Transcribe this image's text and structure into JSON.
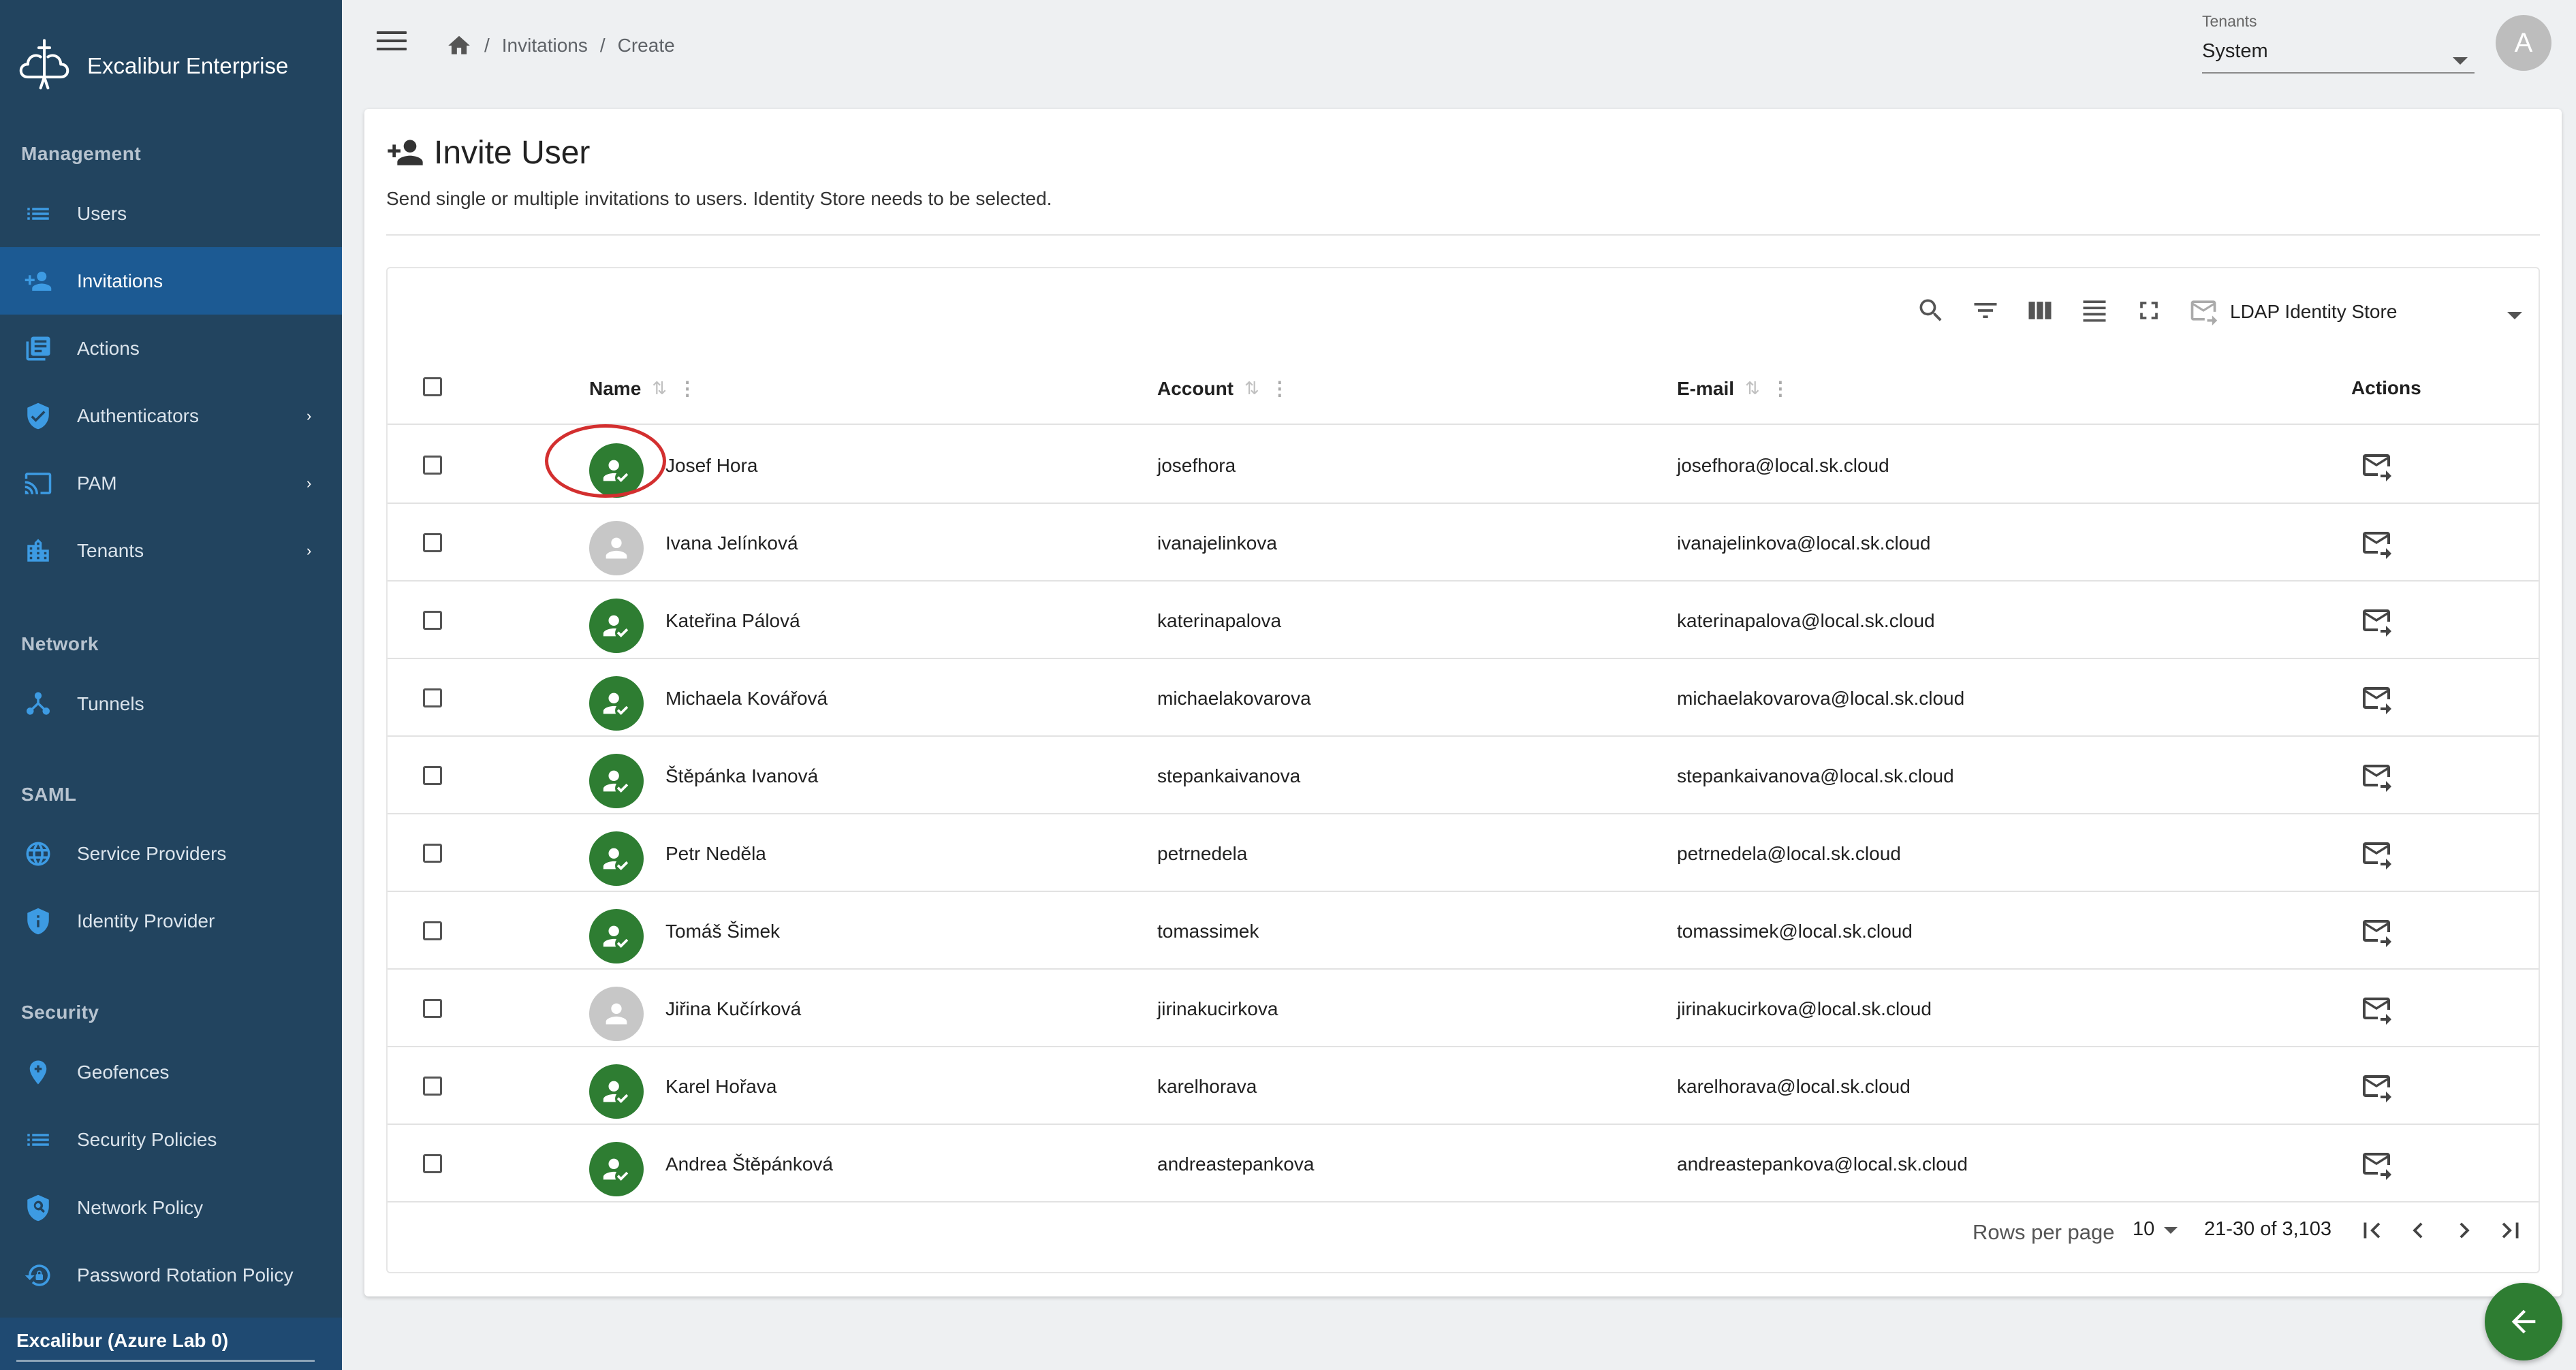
{
  "app": {
    "title": "Excalibur Enterprise"
  },
  "sidebar": {
    "sections": [
      {
        "label": "Management",
        "items": [
          {
            "label": "Users",
            "icon": "list-icon",
            "active": false,
            "has_children": false
          },
          {
            "label": "Invitations",
            "icon": "person-add-icon",
            "active": true,
            "has_children": false
          },
          {
            "label": "Actions",
            "icon": "article-icon",
            "active": false,
            "has_children": false
          },
          {
            "label": "Authenticators",
            "icon": "shield-check-icon",
            "active": false,
            "has_children": true
          },
          {
            "label": "PAM",
            "icon": "cast-icon",
            "active": false,
            "has_children": true
          },
          {
            "label": "Tenants",
            "icon": "building-icon",
            "active": false,
            "has_children": true
          }
        ]
      },
      {
        "label": "Network",
        "items": [
          {
            "label": "Tunnels",
            "icon": "hub-icon",
            "active": false,
            "has_children": false
          }
        ]
      },
      {
        "label": "SAML",
        "items": [
          {
            "label": "Service Providers",
            "icon": "globe-icon",
            "active": false,
            "has_children": false
          },
          {
            "label": "Identity Provider",
            "icon": "shield-info-icon",
            "active": false,
            "has_children": false
          }
        ]
      },
      {
        "label": "Security",
        "items": [
          {
            "label": "Geofences",
            "icon": "location-icon",
            "active": false,
            "has_children": false
          },
          {
            "label": "Security Policies",
            "icon": "list-icon",
            "active": false,
            "has_children": false
          },
          {
            "label": "Network Policy",
            "icon": "shield-search-icon",
            "active": false,
            "has_children": false
          },
          {
            "label": "Password Rotation Policy",
            "icon": "lock-reset-icon",
            "active": false,
            "has_children": false
          }
        ]
      }
    ],
    "footer": "Excalibur (Azure Lab 0)"
  },
  "topbar": {
    "breadcrumb": [
      "Invitations",
      "Create"
    ],
    "tenant_label": "Tenants",
    "tenant_value": "System",
    "avatar_initial": "A"
  },
  "page": {
    "title": "Invite User",
    "subtitle": "Send single or multiple invitations to users. Identity Store needs to be selected."
  },
  "table": {
    "toolbar_icons": [
      "search-icon",
      "filter-icon",
      "columns-icon",
      "density-icon",
      "fullscreen-icon",
      "invite-all-icon"
    ],
    "identity_store": "LDAP Identity Store",
    "columns": {
      "name": "Name",
      "account": "Account",
      "email": "E-mail",
      "actions": "Actions"
    },
    "rows": [
      {
        "name": "Josef Hora",
        "account": "josefhora",
        "email": "josefhora@local.sk.cloud",
        "verified": true
      },
      {
        "name": "Ivana Jelínková",
        "account": "ivanajelinkova",
        "email": "ivanajelinkova@local.sk.cloud",
        "verified": false
      },
      {
        "name": "Kateřina Pálová",
        "account": "katerinapalova",
        "email": "katerinapalova@local.sk.cloud",
        "verified": true
      },
      {
        "name": "Michaela Kovářová",
        "account": "michaelakovarova",
        "email": "michaelakovarova@local.sk.cloud",
        "verified": true
      },
      {
        "name": "Štěpánka Ivanová",
        "account": "stepankaivanova",
        "email": "stepankaivanova@local.sk.cloud",
        "verified": true
      },
      {
        "name": "Petr Neděla",
        "account": "petrnedela",
        "email": "petrnedela@local.sk.cloud",
        "verified": true
      },
      {
        "name": "Tomáš Šimek",
        "account": "tomassimek",
        "email": "tomassimek@local.sk.cloud",
        "verified": true
      },
      {
        "name": "Jiřina Kučírková",
        "account": "jirinakucirkova",
        "email": "jirinakucirkova@local.sk.cloud",
        "verified": false
      },
      {
        "name": "Karel Hořava",
        "account": "karelhorava",
        "email": "karelhorava@local.sk.cloud",
        "verified": true
      },
      {
        "name": "Andrea Štěpánková",
        "account": "andreastepankova",
        "email": "andreastepankova@local.sk.cloud",
        "verified": true
      }
    ],
    "pagination": {
      "rows_per_page_label": "Rows per page",
      "rows_per_page": "10",
      "range": "21-30 of 3,103"
    }
  },
  "colors": {
    "sidebar": "#22445f",
    "active": "#1c5a93",
    "icon": "#3d9be3",
    "verified": "#2e7d32",
    "unverified": "#c7c7c7",
    "highlight": "#d32f2f"
  }
}
